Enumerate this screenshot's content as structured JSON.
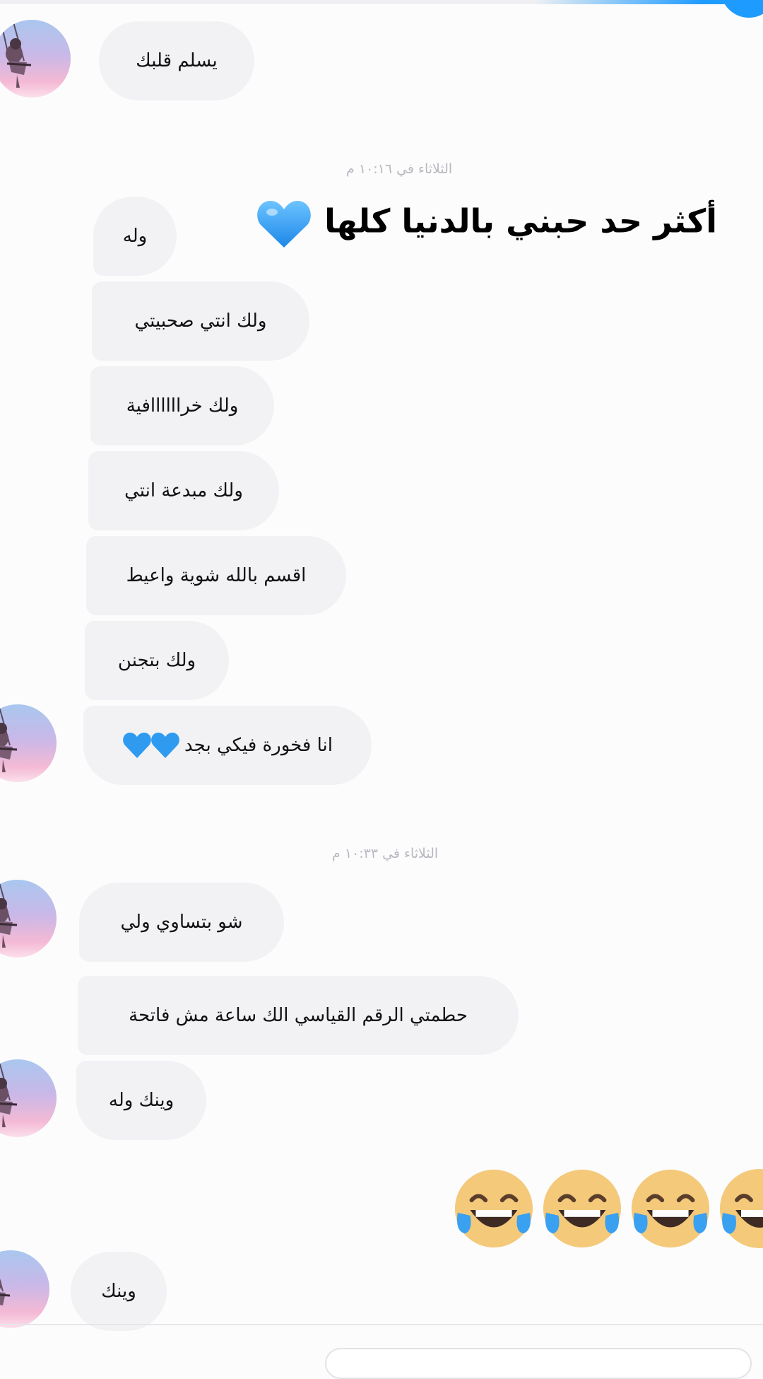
{
  "caption": "أكثر حد حبني بالدنيا كلها",
  "timestamps": [
    "الثلاثاء في ١٠:١٦ م",
    "الثلاثاء في ١٠:٣٣ م"
  ],
  "messages": [
    {
      "text": "يسلم قلبك"
    },
    {
      "text": "وله"
    },
    {
      "text": "ولك انتي صحبيتي"
    },
    {
      "text": "ولك خراااااافية"
    },
    {
      "text": "ولك مبدعة انتي"
    },
    {
      "text": "اقسم بالله شوية واعيط"
    },
    {
      "text": "ولك بتجنن"
    },
    {
      "text": "انا فخورة فيكي بجد"
    },
    {
      "text": "شو بتساوي ولي"
    },
    {
      "text": "حطمتي الرقم القياسي الك ساعة مش فاتحة"
    },
    {
      "text": "وينك وله"
    },
    {
      "text": "وينك"
    }
  ],
  "icons": {
    "heart": "blue-heart-icon",
    "laugh": "face-with-tears-of-joy-icon",
    "avatar": "girl-on-swing-avatar"
  },
  "colors": {
    "bubble": "#f2f2f5",
    "accent": "#1e9bff",
    "heart": "#2f9bf0"
  }
}
